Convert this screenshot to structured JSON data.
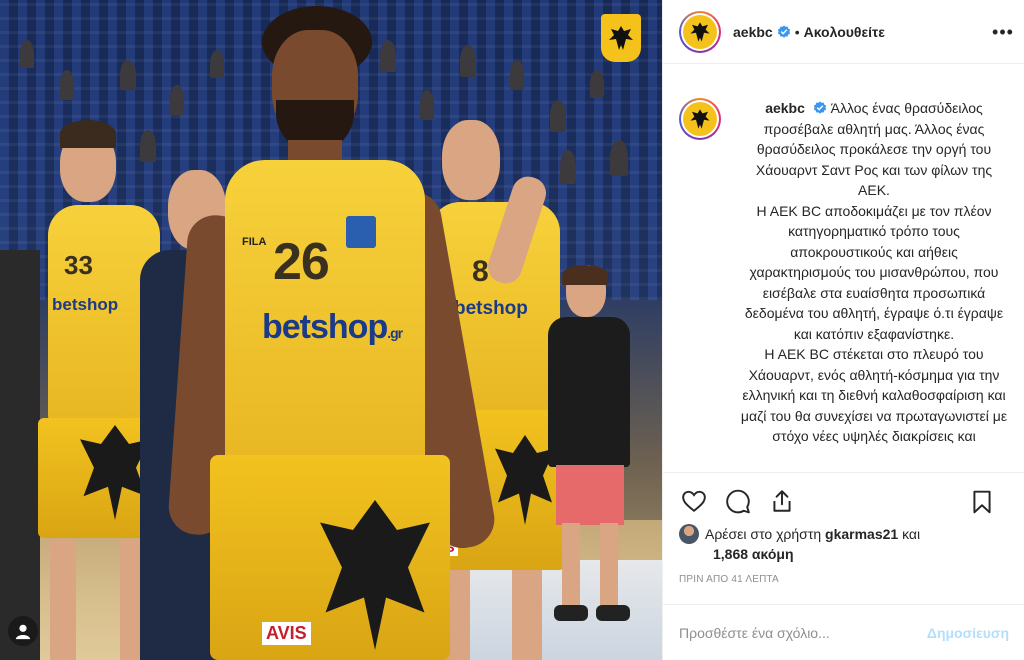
{
  "photo": {
    "jersey_numbers": [
      "33",
      "26",
      "8"
    ],
    "sponsor_text": "betshop",
    "sponsor_suffix": ".gr",
    "shorts_sponsor": "AVIS",
    "brand": "FILA"
  },
  "header": {
    "username": "aekbc",
    "separator": "•",
    "follow_status": "Ακολουθείτε",
    "more": "•••"
  },
  "caption": {
    "username": "aekbc",
    "paragraphs": [
      "Άλλος ένας θρασύδειλος προσέβαλε αθλητή μας. Άλλος ένας θρασύδειλος προκάλεσε την οργή του Χάουαρντ Σαντ Ρος και των φίλων της ΑΕΚ.",
      "Η ΑΕΚ BC αποδοκιμάζει με τον πλέον κατηγορηματικό τρόπο τους αποκρουστικούς και αήθεις χαρακτηρισμούς του μισανθρώπου, που εισέβαλε στα ευαίσθητα προσωπικά δεδομένα του αθλητή, έγραψε ό.τι έγραψε και κατόπιν εξαφανίστηκε.",
      "Η ΑΕΚ BC στέκεται στο πλευρό του Χάουαρντ, ενός αθλητή-κόσμημα για την ελληνική και τη διεθνή καλαθοσφαίριση και μαζί του θα συνεχίσει να πρωταγωνιστεί με στόχο νέες υψηλές διακρίσεις και"
    ]
  },
  "likes": {
    "prefix": "Αρέσει στο χρήστη",
    "user": "gkarmas21",
    "conj": "και",
    "count": "1,868 ακόμη"
  },
  "timestamp": "ΠΡΙΝ ΑΠΟ 41 ΛΕΠΤΑ",
  "comment": {
    "placeholder": "Προσθέστε ένα σχόλιο...",
    "post_label": "Δημοσίευση"
  },
  "colors": {
    "verified": "#3897f0",
    "post_button": "#b2dffc",
    "jersey": "#f7d13b"
  }
}
